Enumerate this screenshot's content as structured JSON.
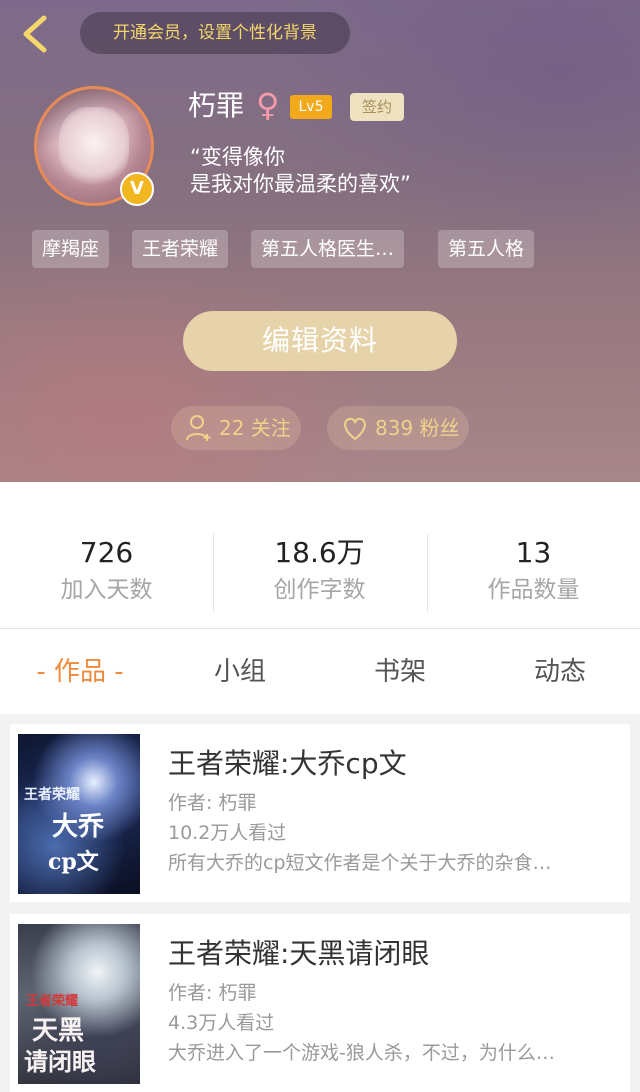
{
  "header": {
    "vip_prompt": "开通会员，设置个性化背景",
    "username": "朽罪",
    "gender_symbol": "♀",
    "level": "Lv5",
    "contract": "签约",
    "signature_line1": "“变得像你",
    "signature_line2": "是我对你最温柔的喜欢”",
    "tags": [
      "摩羯座",
      "王者荣耀",
      "第五人格医生…",
      "第五人格"
    ],
    "edit_button": "编辑资料",
    "following": "22 关注",
    "followers": "839 粉丝",
    "verify_mark": "V"
  },
  "stats": [
    {
      "value": "726",
      "label": "加入天数"
    },
    {
      "value": "18.6万",
      "label": "创作字数"
    },
    {
      "value": "13",
      "label": "作品数量"
    }
  ],
  "tabs": [
    "- 作品 -",
    "小组",
    "书架",
    "动态"
  ],
  "books": [
    {
      "title": "王者荣耀:大乔cp文",
      "author": "作者: 朽罪",
      "views": "10.2万人看过",
      "desc": "所有大乔的cp短文作者是个关于大乔的杂食…",
      "cover_text_a": "王者荣耀",
      "cover_text_b": "大乔",
      "cover_text_c": "cp文"
    },
    {
      "title": "王者荣耀:天黑请闭眼",
      "author": "作者: 朽罪",
      "views": "4.3万人看过",
      "desc": "大乔进入了一个游戏-狼人杀，不过，为什么…",
      "cover_text_a": "王者荣耀",
      "cover_text_b": "天黑",
      "cover_text_c": "请闭眼"
    }
  ],
  "colors": {
    "accent_orange": "#f08a3c",
    "vip_yellow": "#f4d76b",
    "level_badge": "#f3a91c",
    "edit_button": "#e6d3a9"
  }
}
